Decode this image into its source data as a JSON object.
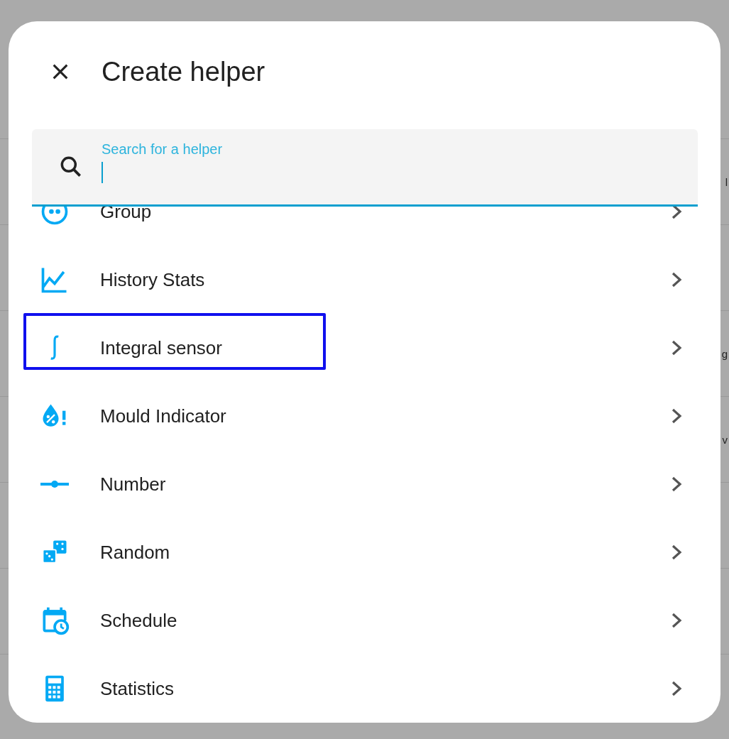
{
  "background_fragments": [
    {
      "text": "l"
    },
    {
      "text": "g"
    },
    {
      "text": "v"
    }
  ],
  "dialog": {
    "title": "Create helper"
  },
  "search": {
    "label": "Search for a helper",
    "focused": true
  },
  "items": [
    {
      "kind": "group",
      "label": "Group",
      "highlighted": false
    },
    {
      "kind": "history",
      "label": "History Stats",
      "highlighted": false
    },
    {
      "kind": "integral",
      "label": "Integral sensor",
      "highlighted": true
    },
    {
      "kind": "mould",
      "label": "Mould Indicator",
      "highlighted": false
    },
    {
      "kind": "number",
      "label": "Number",
      "highlighted": false
    },
    {
      "kind": "random",
      "label": "Random",
      "highlighted": false
    },
    {
      "kind": "schedule",
      "label": "Schedule",
      "highlighted": false
    },
    {
      "kind": "statistics",
      "label": "Statistics",
      "highlighted": false
    }
  ]
}
